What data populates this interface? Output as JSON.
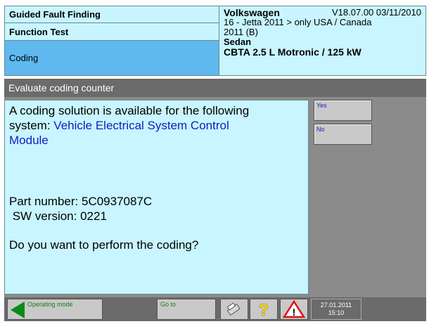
{
  "header": {
    "menu_guided": "Guided Fault Finding",
    "menu_function": "Function Test",
    "menu_coding": "Coding",
    "brand": "Volkswagen",
    "version": "V18.07.00 03/11/2010",
    "vehicle_line1": "16 - Jetta 2011 > only USA / Canada",
    "vehicle_line2": "2011 (B)",
    "body": "Sedan",
    "engine": "CBTA 2.5 L Motronic / 125 kW"
  },
  "title": "Evaluate coding counter",
  "content": {
    "line1": "A coding solution is available for the following",
    "line2_prefix": "system: ",
    "line2_blue": "Vehicle Electrical System Control",
    "line3_blue": "Module",
    "part_number": "Part number: 5C0937087C",
    "sw_version": " SW version: 0221",
    "question": "Do you want to perform the coding?"
  },
  "buttons": {
    "yes": "Yes",
    "no": "No"
  },
  "footer": {
    "operating_mode": "Operating mode",
    "goto": "Go to",
    "date": "27.01.2011",
    "time": "15:10"
  },
  "colors": {
    "header_bg": "#c8f5ff",
    "active_tab": "#5fb9ef",
    "bar": "#6b6b6b",
    "blue_text": "#1020c0",
    "green_arrow": "#0a8a1a"
  },
  "icons": [
    "back-arrow-icon",
    "print-icon",
    "help-icon",
    "warning-icon"
  ]
}
